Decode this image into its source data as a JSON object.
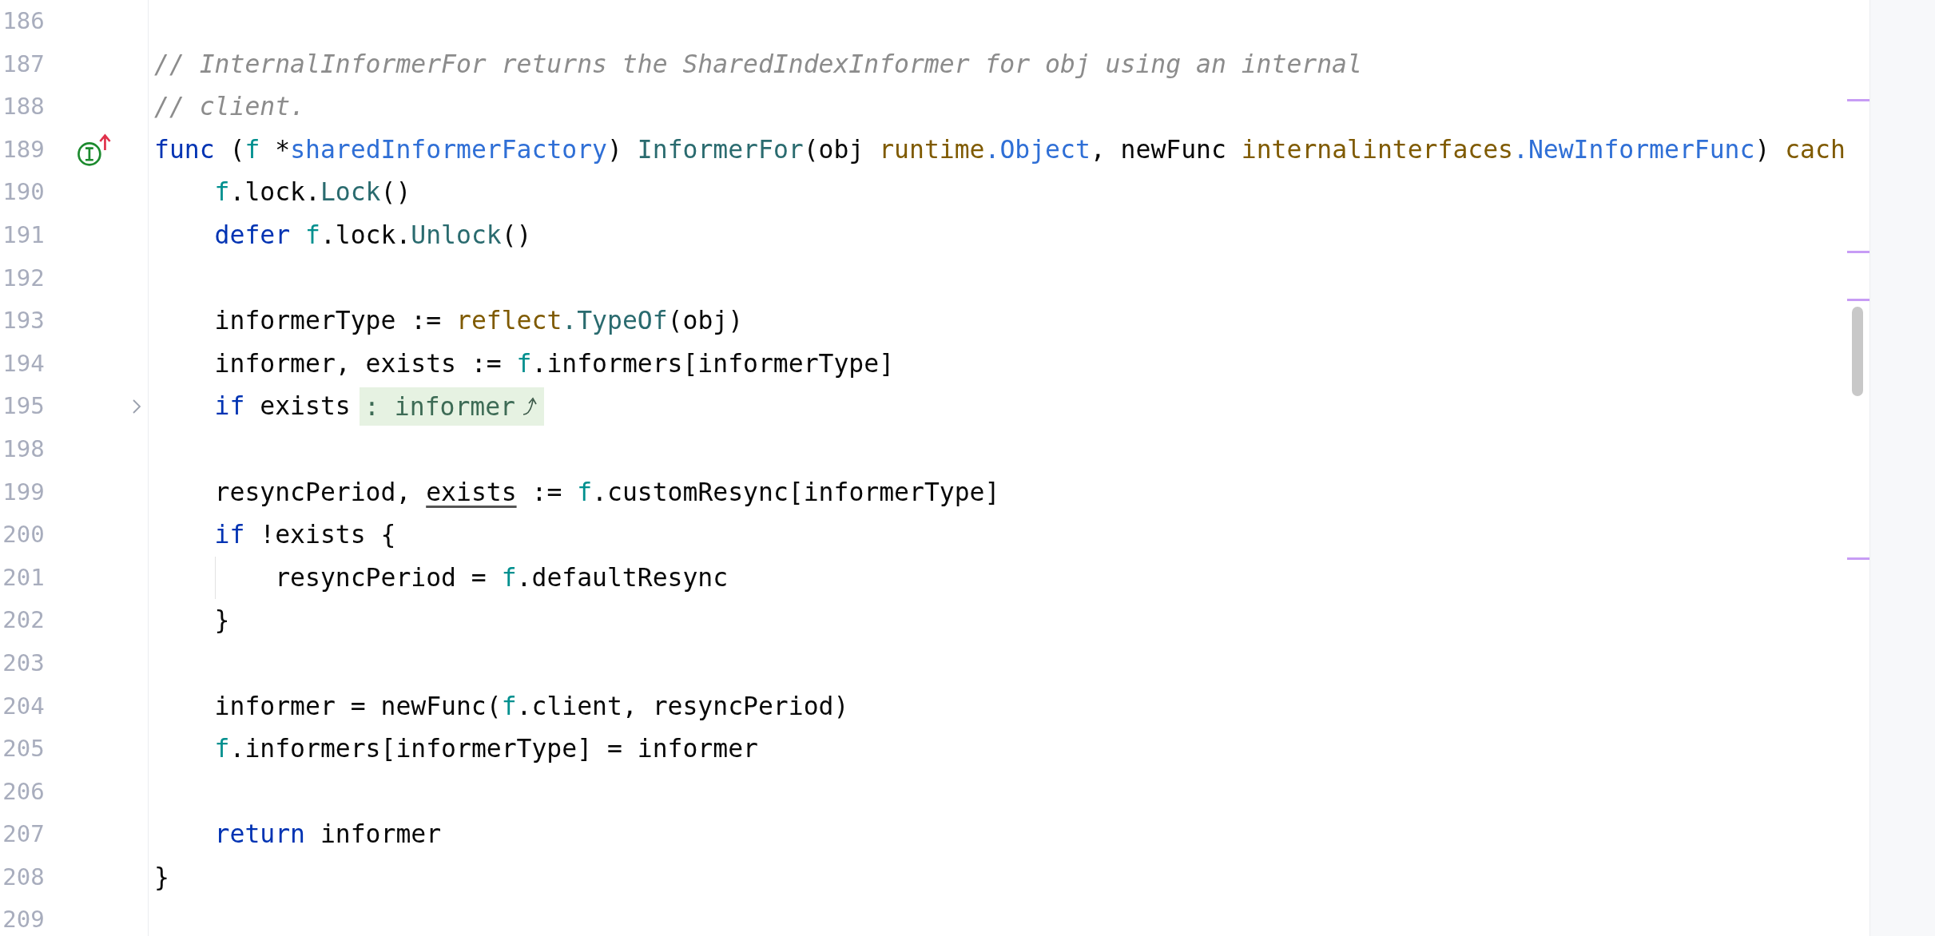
{
  "editor": {
    "lines": [
      {
        "number": "186",
        "kind": "top"
      },
      {
        "number": "187",
        "kind": "top",
        "tokens": [
          {
            "text": "// InternalInformerFor returns the SharedIndexInformer for obj using an internal",
            "kind": "comment"
          }
        ]
      },
      {
        "number": "188",
        "kind": "top",
        "tokens": [
          {
            "text": "// client.",
            "kind": "comment"
          }
        ]
      },
      {
        "number": "189",
        "kind": "top",
        "gutter_icon": {
          "kind": "implements"
        },
        "tokens": [
          {
            "text": "func",
            "kind": "keyword"
          },
          {
            "text": " (",
            "kind": "plain"
          },
          {
            "text": "f",
            "kind": "variable"
          },
          {
            "text": " *",
            "kind": "plain"
          },
          {
            "text": "sharedInformerFactory",
            "kind": "type"
          },
          {
            "text": ") ",
            "kind": "plain"
          },
          {
            "text": "InformerFor",
            "kind": "function"
          },
          {
            "text": "(obj ",
            "kind": "plain"
          },
          {
            "text": "runtime",
            "kind": "package"
          },
          {
            "text": ".Object",
            "kind": "type"
          },
          {
            "text": ", newFunc ",
            "kind": "plain"
          },
          {
            "text": "internalinterfaces",
            "kind": "package"
          },
          {
            "text": ".NewInformerFunc",
            "kind": "type"
          },
          {
            "text": ") ",
            "kind": "plain"
          },
          {
            "text": "cach",
            "kind": "package"
          }
        ]
      },
      {
        "number": "190",
        "kind": "body",
        "tokens": [
          {
            "text": "f",
            "kind": "variable"
          },
          {
            "text": ".lock.",
            "kind": "plain"
          },
          {
            "text": "Lock",
            "kind": "function"
          },
          {
            "text": "()",
            "kind": "plain"
          }
        ]
      },
      {
        "number": "191",
        "kind": "body",
        "tokens": [
          {
            "text": "defer ",
            "kind": "keyword"
          },
          {
            "text": "f",
            "kind": "variable"
          },
          {
            "text": ".lock.",
            "kind": "plain"
          },
          {
            "text": "Unlock",
            "kind": "function"
          },
          {
            "text": "()",
            "kind": "plain"
          }
        ]
      },
      {
        "number": "192",
        "kind": "top"
      },
      {
        "number": "193",
        "kind": "body",
        "tokens": [
          {
            "text": "informerType := ",
            "kind": "plain"
          },
          {
            "text": "reflect",
            "kind": "package"
          },
          {
            "text": ".TypeOf",
            "kind": "function"
          },
          {
            "text": "(obj)",
            "kind": "plain"
          }
        ]
      },
      {
        "number": "194",
        "kind": "body",
        "tokens": [
          {
            "text": "informer, exists := ",
            "kind": "plain"
          },
          {
            "text": "f",
            "kind": "variable"
          },
          {
            "text": ".informers[informerType]",
            "kind": "plain"
          }
        ]
      },
      {
        "number": "195",
        "kind": "body",
        "gutter_icon": {
          "kind": "fold"
        },
        "folded_hint": ": informer",
        "tokens": [
          {
            "text": "if",
            "kind": "keyword"
          },
          {
            "text": " exists",
            "kind": "plain"
          }
        ]
      },
      {
        "number": "198",
        "kind": "top"
      },
      {
        "number": "199",
        "kind": "body",
        "tokens": [
          {
            "text": "resyncPeriod, ",
            "kind": "plain"
          },
          {
            "text": "exists",
            "kind": "underlined"
          },
          {
            "text": " := ",
            "kind": "plain"
          },
          {
            "text": "f",
            "kind": "variable"
          },
          {
            "text": ".customResync[informerType]",
            "kind": "plain"
          }
        ]
      },
      {
        "number": "200",
        "kind": "body",
        "tokens": [
          {
            "text": "if",
            "kind": "keyword"
          },
          {
            "text": " !exists {",
            "kind": "plain"
          }
        ]
      },
      {
        "number": "201",
        "kind": "inner",
        "tokens": [
          {
            "text": "resyncPeriod = ",
            "kind": "plain"
          },
          {
            "text": "f",
            "kind": "variable"
          },
          {
            "text": ".defaultResync",
            "kind": "plain"
          }
        ]
      },
      {
        "number": "202",
        "kind": "body",
        "tokens": [
          {
            "text": "}",
            "kind": "plain"
          }
        ]
      },
      {
        "number": "203",
        "kind": "top"
      },
      {
        "number": "204",
        "kind": "body",
        "tokens": [
          {
            "text": "informer = newFunc(",
            "kind": "plain"
          },
          {
            "text": "f",
            "kind": "variable"
          },
          {
            "text": ".client, resyncPeriod)",
            "kind": "plain"
          }
        ]
      },
      {
        "number": "205",
        "kind": "body",
        "tokens": [
          {
            "text": "f",
            "kind": "variable"
          },
          {
            "text": ".informers[informerType] = informer",
            "kind": "plain"
          }
        ]
      },
      {
        "number": "206",
        "kind": "top"
      },
      {
        "number": "207",
        "kind": "body",
        "tokens": [
          {
            "text": "return",
            "kind": "keyword"
          },
          {
            "text": " informer",
            "kind": "plain"
          }
        ]
      },
      {
        "number": "208",
        "kind": "top",
        "tokens": [
          {
            "text": "}",
            "kind": "plain"
          }
        ]
      },
      {
        "number": "209",
        "kind": "top"
      }
    ]
  }
}
